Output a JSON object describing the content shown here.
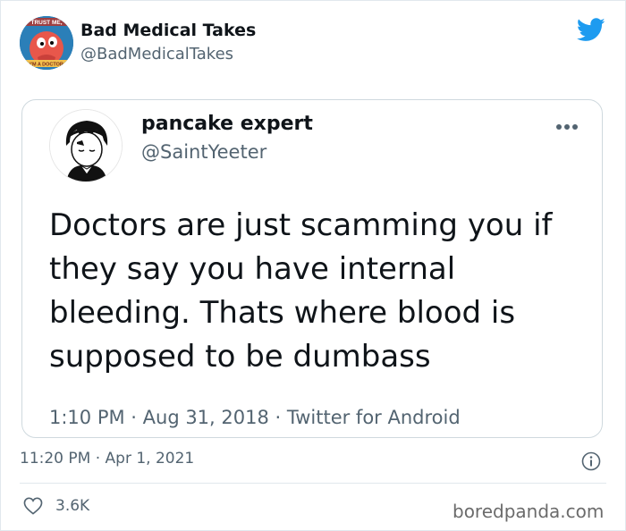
{
  "tweet": {
    "author": {
      "name": "Bad Medical Takes",
      "handle": "@BadMedicalTakes",
      "avatar_text_top": "TRUST ME,",
      "avatar_text_bottom": "I'M A DOCTOR",
      "brand_color": "#1d9bf0"
    },
    "timestamp": "11:20 PM · Apr 1, 2021",
    "likes": "3.6K"
  },
  "quoted_tweet": {
    "name": "pancake expert",
    "handle": "@SaintYeeter",
    "text": "Doctors are just scamming you if\nthey say you have internal\nbleeding. Thats where blood is\nsupposed to be dumbass",
    "meta": "1:10 PM · Aug 31, 2018 · Twitter for Android"
  },
  "icons": {
    "brand": "twitter-bird-icon",
    "more": "more-dots-icon",
    "info": "info-icon",
    "like": "heart-icon"
  },
  "watermark": "boredpanda.com"
}
